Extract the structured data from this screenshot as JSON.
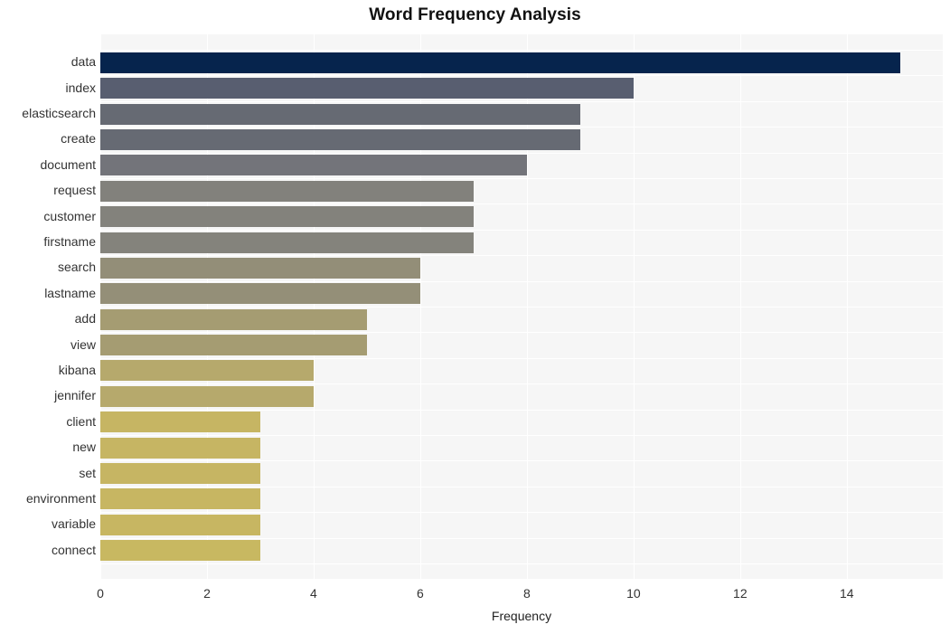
{
  "chart_data": {
    "type": "bar",
    "orientation": "horizontal",
    "title": "Word Frequency Analysis",
    "xlabel": "Frequency",
    "ylabel": "",
    "xlim": [
      0,
      15.8
    ],
    "xticks": [
      0,
      2,
      4,
      6,
      8,
      10,
      12,
      14
    ],
    "xtick_labels": [
      "0",
      "2",
      "4",
      "6",
      "8",
      "10",
      "12",
      "14"
    ],
    "grid": true,
    "legend": null,
    "categories": [
      "data",
      "index",
      "elasticsearch",
      "create",
      "document",
      "request",
      "customer",
      "firstname",
      "search",
      "lastname",
      "add",
      "view",
      "kibana",
      "jennifer",
      "client",
      "new",
      "set",
      "environment",
      "variable",
      "connect"
    ],
    "values": [
      15,
      10,
      9,
      9,
      8,
      7,
      7,
      7,
      6,
      6,
      5,
      5,
      4,
      4,
      3,
      3,
      3,
      3,
      3,
      3
    ],
    "bar_colors": [
      "#06244d",
      "#585e70",
      "#666a73",
      "#666a73",
      "#73747a",
      "#82817c",
      "#83827c",
      "#84837c",
      "#938e78",
      "#948f78",
      "#a59c72",
      "#a59c72",
      "#b6a96c",
      "#b6a96c",
      "#c6b563",
      "#c6b563",
      "#c6b563",
      "#c7b662",
      "#c7b662",
      "#c8b861"
    ],
    "plot_background": "#f6f6f6",
    "grid_color": "#ffffff"
  },
  "figure": {
    "background": "#ffffff",
    "title_color": "#111111",
    "tick_color": "#333333"
  }
}
